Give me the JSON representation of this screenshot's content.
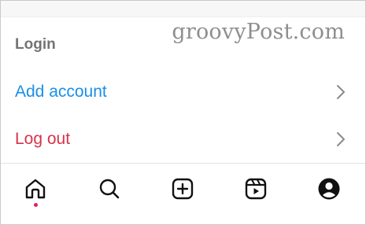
{
  "watermark": "groovyPost.com",
  "section": {
    "title": "Login"
  },
  "rows": [
    {
      "label": "Add account",
      "color": "#1a8fe8"
    },
    {
      "label": "Log out",
      "color": "#d6334a"
    }
  ],
  "tabbar": {
    "items": [
      {
        "icon": "home-icon",
        "active": true
      },
      {
        "icon": "search-icon",
        "active": false
      },
      {
        "icon": "create-plus-icon",
        "active": false
      },
      {
        "icon": "reels-icon",
        "active": false
      },
      {
        "icon": "profile-icon",
        "active": false
      }
    ],
    "active_indicator_color": "#e0245e"
  }
}
